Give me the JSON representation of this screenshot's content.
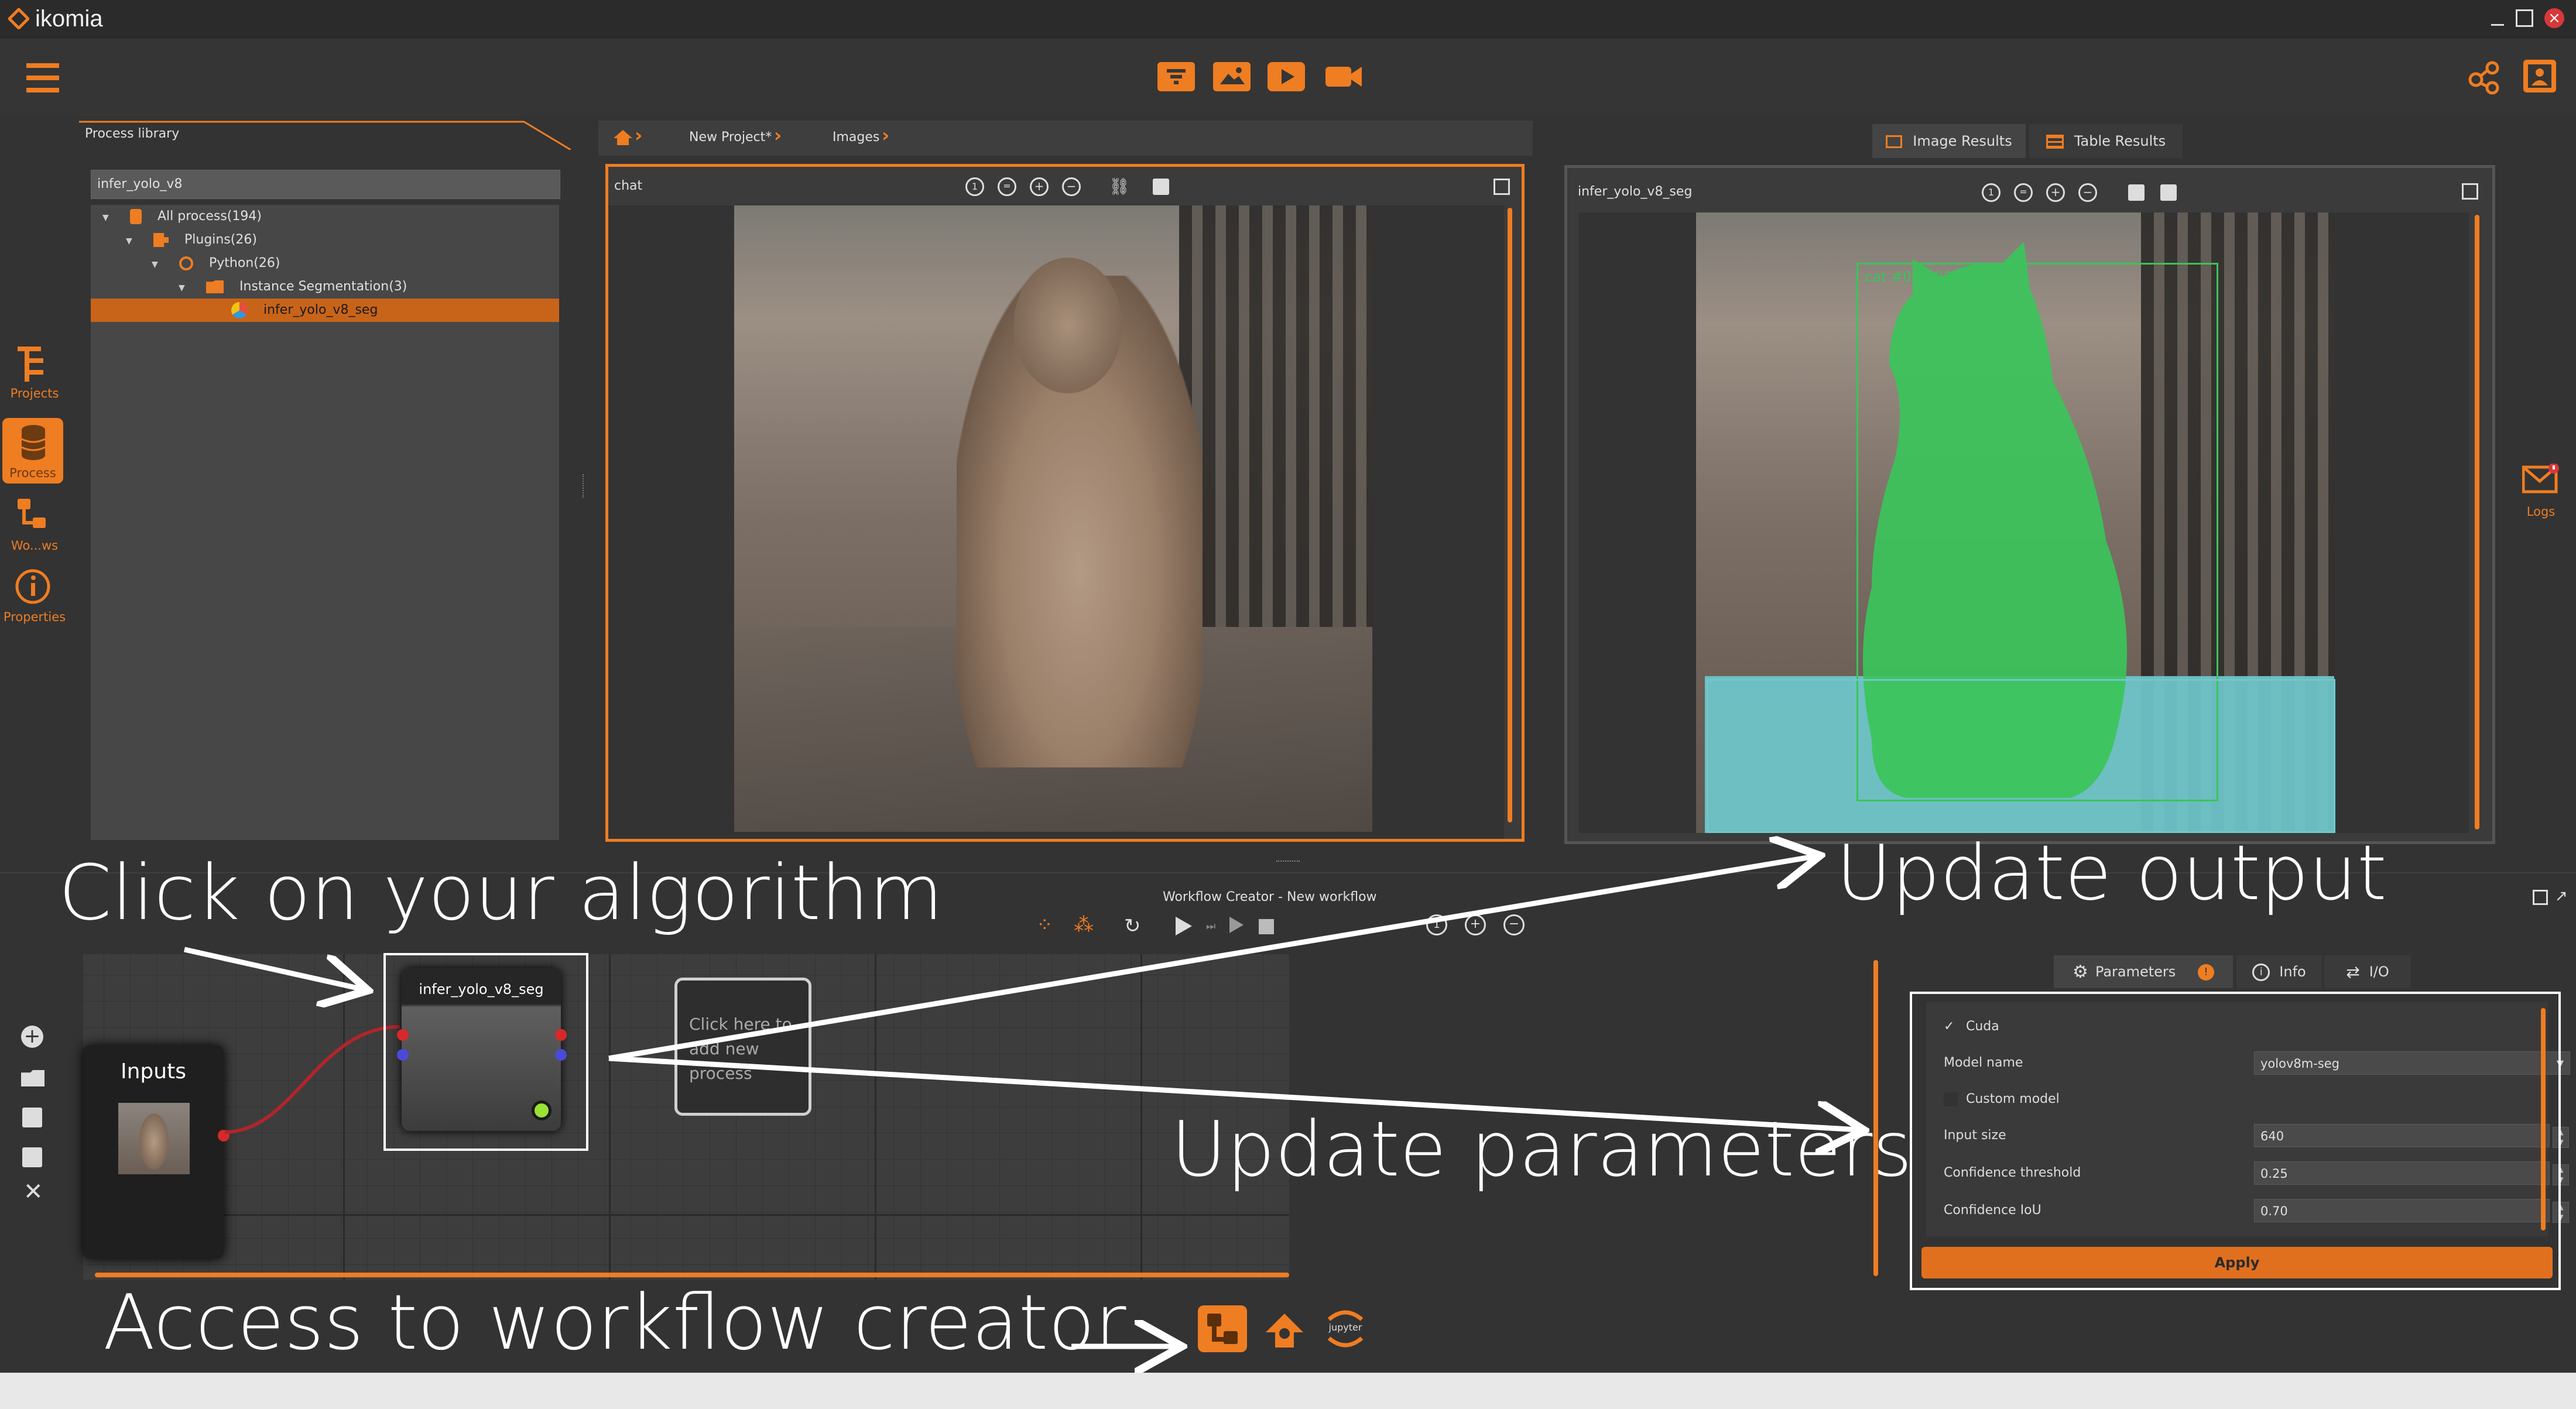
{
  "window": {
    "app_name": "ikomia",
    "controls": [
      "minimize-icon",
      "maximize-icon",
      "close-icon"
    ]
  },
  "toolbar": {
    "center_icons": [
      "stream-icon",
      "image-icon",
      "play-icon",
      "video-icon"
    ],
    "right_icons": [
      "share-icon",
      "user-icon"
    ]
  },
  "sidebar": {
    "items": [
      {
        "label": "Projects",
        "icon": "projects-icon"
      },
      {
        "label": "Process",
        "icon": "database-icon",
        "active": true
      },
      {
        "label": "Wo...ws",
        "icon": "workflow-icon"
      },
      {
        "label": "Properties",
        "icon": "info-icon"
      }
    ]
  },
  "process_library": {
    "title": "Process library",
    "search_value": "infer_yolo_v8",
    "tree": [
      {
        "label": "All process(194)",
        "level": 0
      },
      {
        "label": "Plugins(26)",
        "level": 1
      },
      {
        "label": "Python(26)",
        "level": 2
      },
      {
        "label": "Instance Segmentation(3)",
        "level": 3
      },
      {
        "label": "infer_yolo_v8_seg",
        "level": 4,
        "selected": true
      }
    ]
  },
  "breadcrumb": {
    "items": [
      "New Project*",
      "Images"
    ]
  },
  "tabs": {
    "image_results": "Image Results",
    "table_results": "Table Results"
  },
  "input_view": {
    "title": "chat"
  },
  "output_view": {
    "title": "infer_yolo_v8_seg",
    "detection_label": "cat #0: 0.936523"
  },
  "workflow": {
    "title": "Workflow Creator - New workflow",
    "inputs_node": "Inputs",
    "algo_node": "infer_yolo_v8_seg",
    "add_node": "Click here to add new process"
  },
  "params_tabs": {
    "parameters": "Parameters",
    "info": "Info",
    "io": "I/O"
  },
  "parameters": {
    "cuda_label": "Cuda",
    "cuda_check": "✓",
    "model_name_label": "Model name",
    "model_name_value": "yolov8m-seg",
    "custom_model_label": "Custom model",
    "input_size_label": "Input size",
    "input_size_value": "640",
    "conf_thres_label": "Confidence threshold",
    "conf_thres_value": "0.25",
    "conf_iou_label": "Confidence IoU",
    "conf_iou_value": "0.70",
    "apply_label": "Apply"
  },
  "right_rail": {
    "logs_label": "Logs"
  },
  "bottom_icons": [
    "workflow-creator-icon",
    "publish-icon",
    "jupyter-icon"
  ],
  "jupyter_label": "jupyter",
  "annotations": {
    "click_algo": "Click on your algorithm",
    "update_output": "Update output",
    "update_params": "Update parameters",
    "access_workflow": "Access to workflow creator"
  },
  "colors": {
    "accent": "#ef7d22",
    "mask_green": "#3bc45a",
    "mask_cyan": "#6fc8cc"
  }
}
